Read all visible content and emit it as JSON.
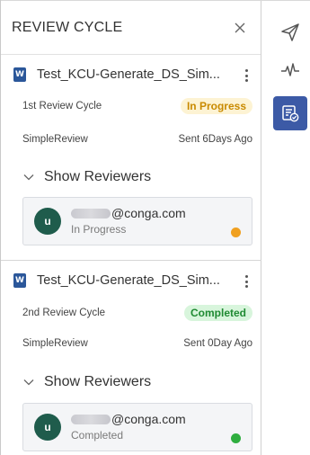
{
  "panel": {
    "title": "REVIEW CYCLE",
    "close_icon": "close-icon"
  },
  "cards": [
    {
      "doc_icon_letter": "W",
      "doc_name": "Test_KCU-Generate_DS_Sim...",
      "cycle_label": "1st Review Cycle",
      "status": "In Progress",
      "type": "SimpleReview",
      "sent": "Sent 6Days Ago",
      "reviewers_toggle": "Show Reviewers",
      "reviewer": {
        "avatar_letter": "u",
        "email_domain": "@conga.com",
        "status": "In Progress",
        "dot_color": "#f0a020"
      }
    },
    {
      "doc_icon_letter": "W",
      "doc_name": "Test_KCU-Generate_DS_Sim...",
      "cycle_label": "2nd Review Cycle",
      "status": "Completed",
      "type": "SimpleReview",
      "sent": "Sent 0Day Ago",
      "reviewers_toggle": "Show Reviewers",
      "reviewer": {
        "avatar_letter": "u",
        "email_domain": "@conga.com",
        "status": "Completed",
        "dot_color": "#2fae3f"
      }
    }
  ],
  "rail": {
    "items": [
      {
        "icon": "send-icon",
        "active": false
      },
      {
        "icon": "activity-icon",
        "active": false
      },
      {
        "icon": "review-list-icon",
        "active": true
      }
    ],
    "active_color": "#3c5aa6"
  },
  "colors": {
    "in_progress_pill_bg": "#fdf3d3",
    "in_progress_pill_text": "#c98a00",
    "completed_pill_bg": "#d8f5dc",
    "completed_pill_text": "#1f8a32",
    "avatar_bg": "#1f5c4c",
    "word_icon_bg": "#2b579a"
  }
}
